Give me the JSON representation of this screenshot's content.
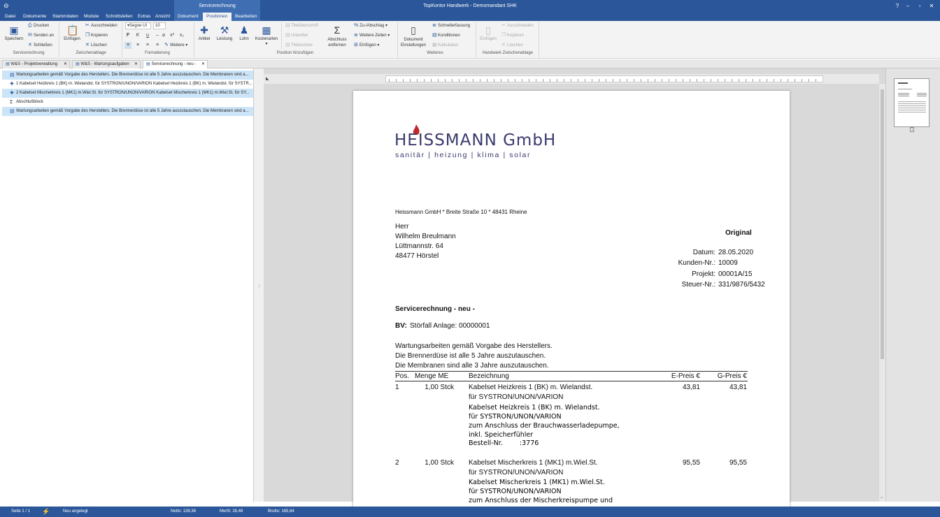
{
  "window": {
    "title": "TopKontor Handwerk - Demomandant SHK",
    "context_group": "Servicerechnung"
  },
  "menu": [
    "Datei",
    "Dokumente",
    "Stammdaten",
    "Module",
    "Schnittstellen",
    "Extras",
    "Ansicht",
    "Dokument",
    "Positionen",
    "Bearbeiten"
  ],
  "ribbon": {
    "servicerechnung": {
      "label": "Servicerechnung",
      "save": "Speichern",
      "print": "Drucken",
      "send": "Senden an",
      "close": "Schließen"
    },
    "clipboard": {
      "label": "Zwischenablage",
      "paste": "Einfügen",
      "cut": "Ausschneiden",
      "copy": "Kopieren",
      "delete": "Löschen"
    },
    "format": {
      "label": "Formatierung",
      "font": "Segoe UI",
      "size": "10",
      "more": "Weitere"
    },
    "position": {
      "label": "Position hinzufügen",
      "article": "Artikel",
      "service": "Leistung",
      "wage": "Lohn",
      "costtypes": "Kostenarten",
      "title_heading": "Titelüberschrift",
      "subtitle": "Untertitel",
      "title_sum": "Titelsumme",
      "remove_closing": "Abschluss entfernen",
      "surcharge": "Zu-/Abschlag",
      "more_lines": "Weitere Zeilen",
      "insert": "Einfügen"
    },
    "more": {
      "label": "Weiteres",
      "doc_settings": "Dokument Einstellungen",
      "quick_entry": "Schnellerfassung",
      "conditions": "Konditionen",
      "calculation": "Kalkulation"
    },
    "hw_clipboard": {
      "label": "Handwerk Zwischenablage",
      "paste": "Einfügen",
      "cut": "Ausschneiden",
      "copy": "Kopieren",
      "delete": "Löschen"
    }
  },
  "doc_tabs": [
    "W&S - Projektverwaltung",
    "W&S - Wartungsaufgaben",
    "Servicerechnung - neu -"
  ],
  "left_items": [
    "Wartungsarbeiten gemäß Vorgabe des Herstellers. Die Brennerdüse ist alle 5 Jahre auszutauschen. Die Membranen sind a...",
    "1 Kabelset Heizkreis 1 (BK) m. Wielandst. für SYSTRON/UNON/VARION Kabelset Heizkreis 1 (BK) m. Wielandst. für SYSTR...",
    "2 Kabelset Mischerkreis 1 (MK1) m.Wiel.St. für SYSTRON/UNON/VARION Kabelset Mischerkreis 1 (MK1) m.Wiel.St. für SY...",
    "Abschlußblock",
    "Wartungsarbeiten gemäß Vorgabe des Herstellers. Die Brennerdüse ist alle 5 Jahre auszutauschen. Die Membranen sind a..."
  ],
  "document": {
    "logo_name": "HEISSMANN GmbH",
    "logo_sub": "sanitär | heizung | klima | solar",
    "sender_line": "Heissmann GmbH * Breite Straße 10 * 48431 Rheine",
    "address": [
      "Herr",
      "Wilhelm Breulmann",
      "Lüttmannstr. 64",
      "48477 Hörstel"
    ],
    "original": "Original",
    "meta": [
      {
        "label": "Datum:",
        "value": "28.05.2020"
      },
      {
        "label": "Kunden-Nr.:",
        "value": "10009"
      },
      {
        "label": "Projekt:",
        "value": "00001A/15"
      },
      {
        "label": "Steuer-Nr.:",
        "value": "331/9876/5432"
      }
    ],
    "heading": "Servicerechnung - neu -",
    "bv_label": "BV:",
    "bv_value": "Störfall Anlage: 00000001",
    "intro": [
      "Wartungsarbeiten gemäß Vorgabe des Herstellers.",
      "Die Brennerdüse ist alle 5 Jahre auszutauschen.",
      "Die Membranen sind alle 3 Jahre auszutauschen."
    ],
    "columns": {
      "pos": "Pos.",
      "qty": "Menge ME",
      "desc": "Bezeichnung",
      "unit": "E-Preis €",
      "total": "G-Preis €"
    },
    "positions": [
      {
        "pos": "1",
        "qty": "1,00 Stck",
        "desc": [
          "Kabelset Heizkreis 1 (BK) m. Wielandst.",
          "für SYSTRON/UNON/VARION"
        ],
        "long": [
          "Kabelset Heizkreis 1 (BK) m. Wielandst.",
          "für SYSTRON/UNON/VARION",
          "zum Anschluss der Brauchwasserladepumpe,",
          "inkl. Speicherfühler",
          "Bestell-Nr.        :3776"
        ],
        "unit": "43,81",
        "total": "43,81"
      },
      {
        "pos": "2",
        "qty": "1,00 Stck",
        "desc": [
          "Kabelset Mischerkreis 1 (MK1) m.Wiel.St.",
          "für SYSTRON/UNON/VARION"
        ],
        "long": [
          "Kabelset Mischerkreis 1 (MK1) m.Wiel.St.",
          "für SYSTRON/UNON/VARION",
          "zum Anschluss der Mischerkreispumpe und"
        ],
        "unit": "95,55",
        "total": "95,55"
      }
    ]
  },
  "status": {
    "page": "Seite 1 / 1",
    "state": "Neu angelegt",
    "net": "Netto: 139,36",
    "vat": "MwSt: 26,48",
    "gross": "Brutto: 165,84"
  },
  "colors": {
    "accent": "#2b579a",
    "logo": "#3a3a6e",
    "flame": "#c0282d"
  }
}
